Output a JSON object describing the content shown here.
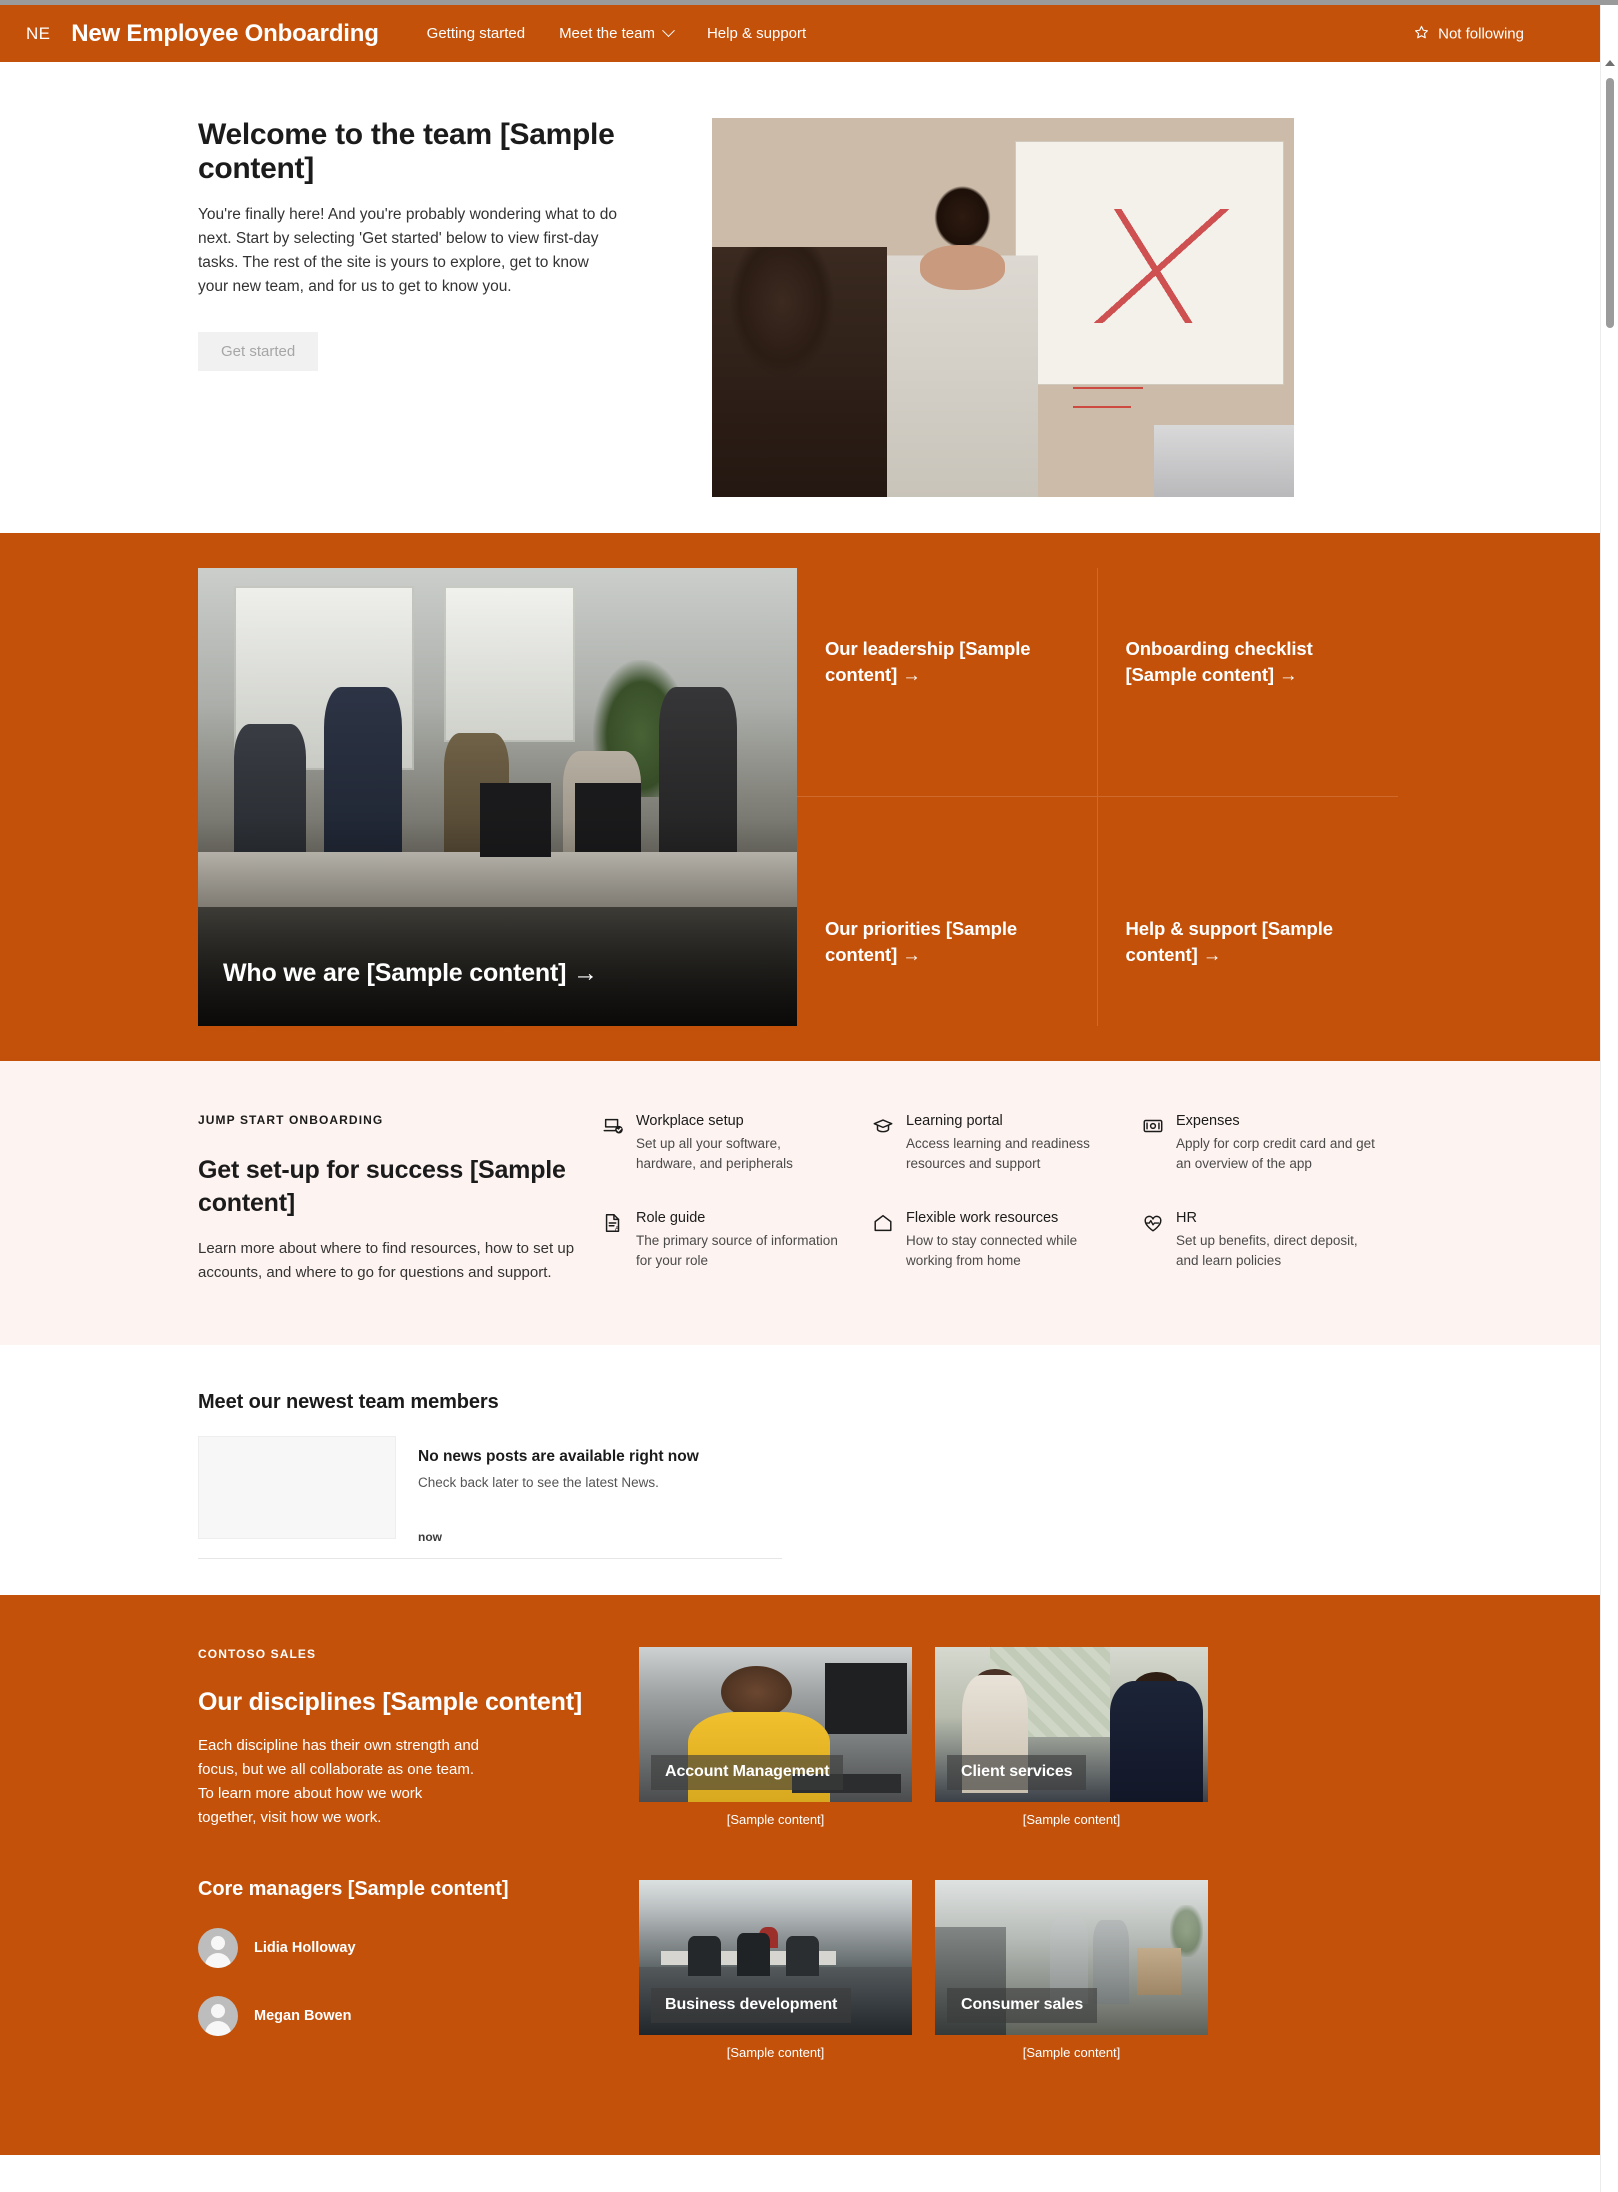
{
  "header": {
    "logo_initials": "NE",
    "site_title": "New Employee Onboarding",
    "nav": [
      {
        "label": "Getting started",
        "has_chevron": false
      },
      {
        "label": "Meet the team",
        "has_chevron": true
      },
      {
        "label": "Help & support",
        "has_chevron": false
      }
    ],
    "follow_label": "Not following",
    "follow_icon": "star-outline-icon",
    "accent_color": "#c3510a"
  },
  "hero": {
    "title": "Welcome to the team [Sample content]",
    "body": "You're finally here! And you're probably wondering what to do next. Start by selecting 'Get started' below to view first-day tasks. The rest of the site is yours to explore, get to know your new team, and for us to get to know you.",
    "button_label": "Get started",
    "image_alt": "presenter-at-whiteboard-photo"
  },
  "quicklinks": {
    "feature_tile": {
      "label": "Who we are [Sample content]",
      "arrow": "→",
      "image_alt": "team-around-desk-photo"
    },
    "tiles": [
      {
        "label": "Our leadership [Sample content]",
        "arrow": "→"
      },
      {
        "label": "Onboarding checklist [Sample content]",
        "arrow": "→"
      },
      {
        "label": "Our priorities [Sample content]",
        "arrow": "→"
      },
      {
        "label": "Help & support [Sample content]",
        "arrow": "→"
      }
    ],
    "background_color": "#c3510a"
  },
  "jumpstart": {
    "eyebrow": "JUMP START ONBOARDING",
    "title": "Get set-up for success [Sample content]",
    "body": "Learn more about where to find resources, how to set up accounts, and where to go for questions and support.",
    "background_color": "#fdf3f0",
    "links": [
      {
        "icon": "laptop-check-icon",
        "name": "Workplace setup",
        "desc": "Set up all your software, hardware, and peripherals"
      },
      {
        "icon": "graduation-cap-icon",
        "name": "Learning portal",
        "desc": "Access learning and readiness resources and support"
      },
      {
        "icon": "money-bill-icon",
        "name": "Expenses",
        "desc": "Apply for corp credit card and get an overview of the app"
      },
      {
        "icon": "document-person-icon",
        "name": "Role guide",
        "desc": "The primary source of information for your role"
      },
      {
        "icon": "home-icon",
        "name": "Flexible work resources",
        "desc": "How to stay connected while working from home"
      },
      {
        "icon": "heart-pulse-icon",
        "name": "HR",
        "desc": "Set up benefits, direct deposit, and learn policies"
      }
    ]
  },
  "news": {
    "title": "Meet our newest team members",
    "empty_heading": "No news posts are available right now",
    "empty_sub": "Check back later to see the latest News.",
    "timestamp": "now"
  },
  "disciplines": {
    "eyebrow": "CONTOSO SALES",
    "title": "Our disciplines [Sample content]",
    "body": "Each discipline has their own strength and focus, but we all collaborate as one team. To learn more about how we work together, visit how we work.",
    "managers_title": "Core managers [Sample content]",
    "managers": [
      {
        "name": "Lidia Holloway",
        "avatar": "person-avatar-icon"
      },
      {
        "name": "Megan Bowen",
        "avatar": "person-avatar-icon"
      }
    ],
    "background_color": "#c3510a",
    "cards": [
      {
        "label": "Account Management",
        "caption": "[Sample content]",
        "image_alt": "headset-agent-photo"
      },
      {
        "label": "Client services",
        "caption": "[Sample content]",
        "image_alt": "two-colleagues-talking-photo"
      },
      {
        "label": "Business development",
        "caption": "[Sample content]",
        "image_alt": "meeting-room-photo"
      },
      {
        "label": "Consumer sales",
        "caption": "[Sample content]",
        "image_alt": "storefront-shoppers-photo"
      }
    ]
  }
}
